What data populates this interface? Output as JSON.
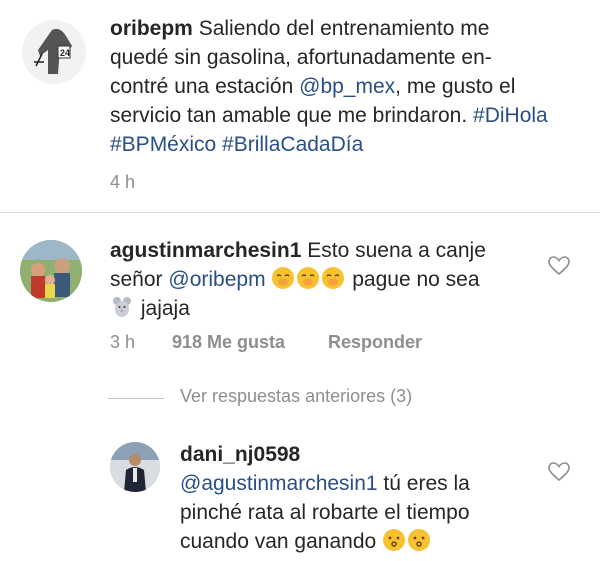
{
  "caption": {
    "username": "oribepm",
    "text_before": "Saliendo del entrenamiento me quedé sin gasolina, afortunadamente en-contré una estación ",
    "mention": "@bp_mex",
    "text_after": ", me gusto el servicio tan amable que me brindaron. ",
    "hashtags": "#DiHola #BPMéxico #BrillaCadaDía",
    "time": "4 h"
  },
  "comment1": {
    "username": "agustinmarchesin1",
    "text_before": "Esto suena a canje señor ",
    "mention": "@oribepm",
    "text_middle": " pague no sea",
    "text_end": "jajaja",
    "time": "3 h",
    "likes": "918 Me gusta",
    "reply_label": "Responder"
  },
  "view_replies": "Ver respuestas anteriores (3)",
  "reply": {
    "username": "dani_nj0598",
    "mention": "@agustinmarchesin1",
    "text": " tú eres la pinché rata al robarte el tiempo cuando van ganando"
  },
  "icons": {
    "heart": "heart-icon",
    "emoji_hush": "hushed-face-emoji",
    "emoji_kiss": "kissing-face-emoji",
    "emoji_mouse": "mouse-emoji"
  },
  "colors": {
    "link": "#2a4f86",
    "meta": "#8e8e8e",
    "divider": "#dbdbdb"
  }
}
